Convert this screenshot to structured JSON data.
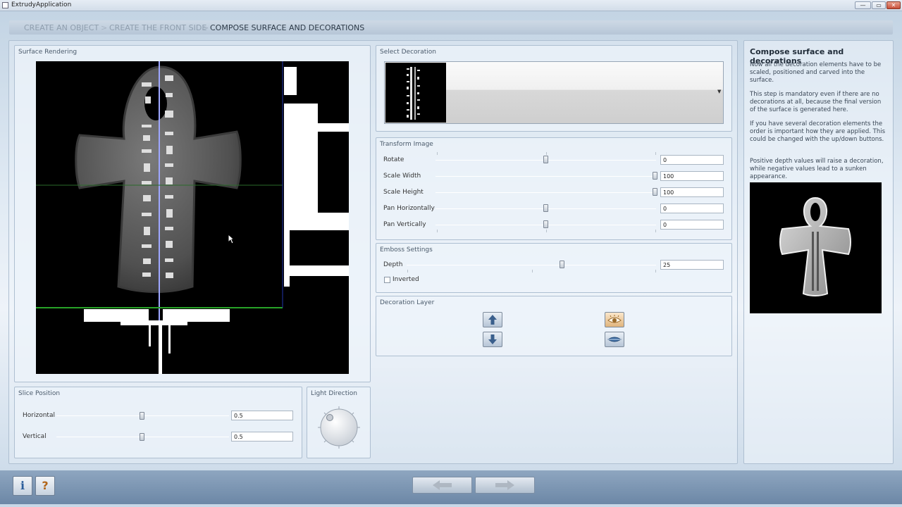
{
  "window": {
    "title": "ExtrudyApplication"
  },
  "breadcrumb": {
    "steps": [
      "CREATE AN OBJECT",
      "CREATE THE FRONT SIDE",
      "COMPOSE SURFACE AND DECORATIONS"
    ],
    "separator": ">"
  },
  "surface_rendering": {
    "title": "Surface Rendering"
  },
  "slice_position": {
    "title": "Slice Position",
    "horizontal": {
      "label": "Horizontal",
      "value": "0.5"
    },
    "vertical": {
      "label": "Vertical",
      "value": "0.5"
    }
  },
  "light_direction": {
    "title": "Light Direction"
  },
  "select_decoration": {
    "title": "Select Decoration"
  },
  "transform_image": {
    "title": "Transform Image",
    "rows": [
      {
        "label": "Rotate",
        "value": "0"
      },
      {
        "label": "Scale Width",
        "value": "100"
      },
      {
        "label": "Scale Height",
        "value": "100"
      },
      {
        "label": "Pan Horizontally",
        "value": "0"
      },
      {
        "label": "Pan Vertically",
        "value": "0"
      }
    ]
  },
  "emboss_settings": {
    "title": "Emboss Settings",
    "depth": {
      "label": "Depth",
      "value": "25"
    },
    "inverted": {
      "label": "Inverted",
      "checked": false
    }
  },
  "decoration_layer": {
    "title": "Decoration Layer"
  },
  "info": {
    "heading": "Compose surface and decorations",
    "paragraphs": [
      "Now all the decoration elements have to be scaled, positioned and carved into the surface.",
      "This step is mandatory even if there are no decorations at all, because the final version of the surface is generated here.",
      "If you have several decoration elements the order is important how they are applied. This could be changed with the up/down buttons.",
      "Positive depth values will raise a decoration, while negative values lead to a sunken appearance."
    ]
  },
  "icons": {
    "app": "app-icon",
    "up": "arrow-up-icon",
    "down": "arrow-down-icon",
    "visible": "eye-icon",
    "hidden": "eye-closed-icon",
    "back": "arrow-left-icon",
    "forward": "arrow-right-icon",
    "info": "info-icon",
    "help": "help-icon"
  },
  "window_controls": {
    "minimize": "—",
    "maximize": "▭",
    "close": "✕"
  },
  "help_labels": {
    "info": "i",
    "help": "?"
  }
}
